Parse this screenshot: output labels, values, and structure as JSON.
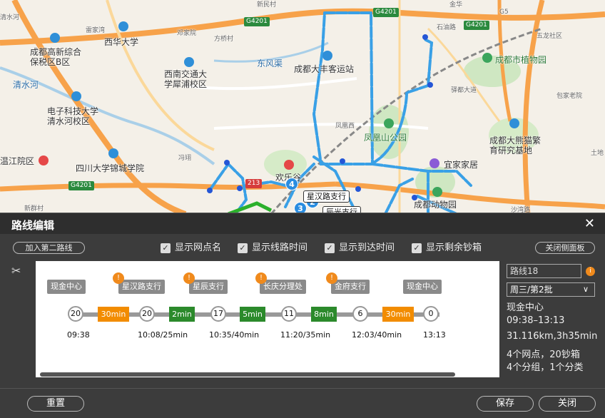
{
  "map": {
    "labels": [
      "西华大学",
      "成都高新综合保税区B区",
      "西南交通大学犀浦校区",
      "成都大丰客运站",
      "电子科技大学清水河校区",
      "四川大学锦城学院",
      "凤凰山公园",
      "宜家家居",
      "成都动物园",
      "成都市植物园",
      "成都大熊猫繁育研究基地",
      "五龙社区",
      "土地",
      "包家老院",
      "金华",
      "石油路",
      "驿都大道",
      "凤凰西",
      "邓家院",
      "方桥村",
      "雷家湾",
      "新民村",
      "东风渠",
      "清水河",
      "G4201",
      "G4201",
      "G4201",
      "G4201",
      "G5",
      "温江院区",
      "新群村",
      "冯翊",
      "清水河",
      "欢乐谷",
      "沙湾路"
    ],
    "bank_pins": [
      "星汉路支行",
      "辰光支行"
    ],
    "pin_numbers": [
      "2",
      "3",
      "4"
    ],
    "road_tag": "213"
  },
  "panel": {
    "title": "路线编辑",
    "add_second_route": "加入第二路线",
    "close_side_panel": "关闭侧面板",
    "checkboxes": [
      "显示网点名",
      "显示线路时间",
      "显示到达时间",
      "显示剩余钞箱"
    ],
    "stops": [
      {
        "name": "现金中心",
        "node": "20",
        "time": "09:38",
        "warn": false
      },
      {
        "name": "星汉路支行",
        "node": "20",
        "time": "10:08/25min",
        "warn": true
      },
      {
        "name": "星辰支行",
        "node": "17",
        "time": "10:35/40min",
        "warn": true
      },
      {
        "name": "长庆分理处",
        "node": "11",
        "time": "11:20/35min",
        "warn": true
      },
      {
        "name": "金府支行",
        "node": "6",
        "time": "12:03/40min",
        "warn": true
      },
      {
        "name": "现金中心",
        "node": "0",
        "time": "13:13",
        "warn": false
      }
    ],
    "durations": [
      {
        "label": "30min",
        "color": "orange"
      },
      {
        "label": "2min",
        "color": "green"
      },
      {
        "label": "5min",
        "color": "green"
      },
      {
        "label": "8min",
        "color": "green"
      },
      {
        "label": "30min",
        "color": "orange"
      }
    ],
    "side": {
      "route_name": "路线18",
      "batch": "周三/第2批",
      "info": [
        "现金中心",
        "09:38–13:13",
        "31.116km,3h35min",
        "4个网点，20钞箱",
        "4个分组，1个分类"
      ]
    },
    "footer": {
      "reset": "重置",
      "save": "保存",
      "close": "关闭"
    },
    "warn_icon": "!",
    "close_icon": "✕",
    "scissors_icon": "✂"
  }
}
